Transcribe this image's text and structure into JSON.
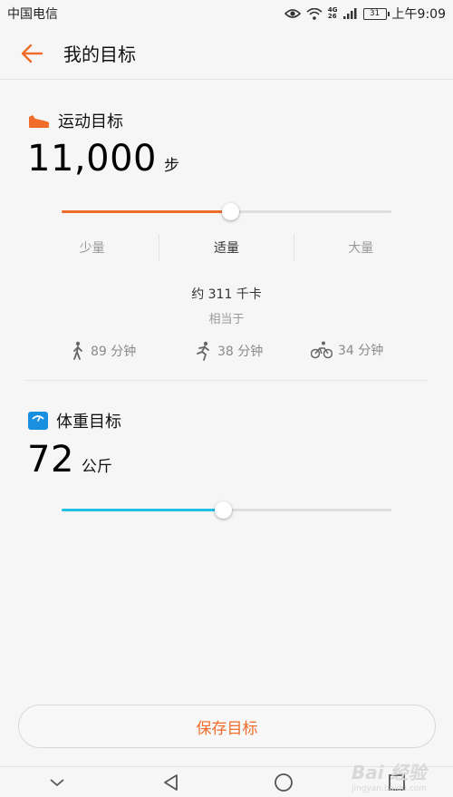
{
  "status_bar": {
    "carrier": "中国电信",
    "network_top": "4G",
    "network_bottom": "26",
    "battery": "31",
    "time": "上午9:09"
  },
  "header": {
    "title": "我的目标",
    "back_icon": "arrow-left-icon"
  },
  "steps_goal": {
    "title": "运动目标",
    "icon": "shoe-icon",
    "value": "11,000",
    "unit": "步",
    "slider_fraction": 0.51,
    "accent": "#ef6c2b",
    "levels": [
      {
        "label": "少量"
      },
      {
        "label": "适量"
      },
      {
        "label": "大量"
      }
    ],
    "selected_level": "适量",
    "calories": "约 311 千卡",
    "equivalent_label": "相当于",
    "equivalents": [
      {
        "icon": "walk-icon",
        "label": "89 分钟"
      },
      {
        "icon": "run-icon",
        "label": "38 分钟"
      },
      {
        "icon": "bike-icon",
        "label": "34 分钟"
      }
    ]
  },
  "weight_goal": {
    "title": "体重目标",
    "icon": "scale-icon",
    "value": "72",
    "unit": "公斤",
    "slider_fraction": 0.49,
    "accent": "#1ec0e6"
  },
  "save_button": {
    "label": "保存目标"
  },
  "watermark": {
    "text": "Bai 经验",
    "subtext": "jingyan.baidu.com"
  }
}
